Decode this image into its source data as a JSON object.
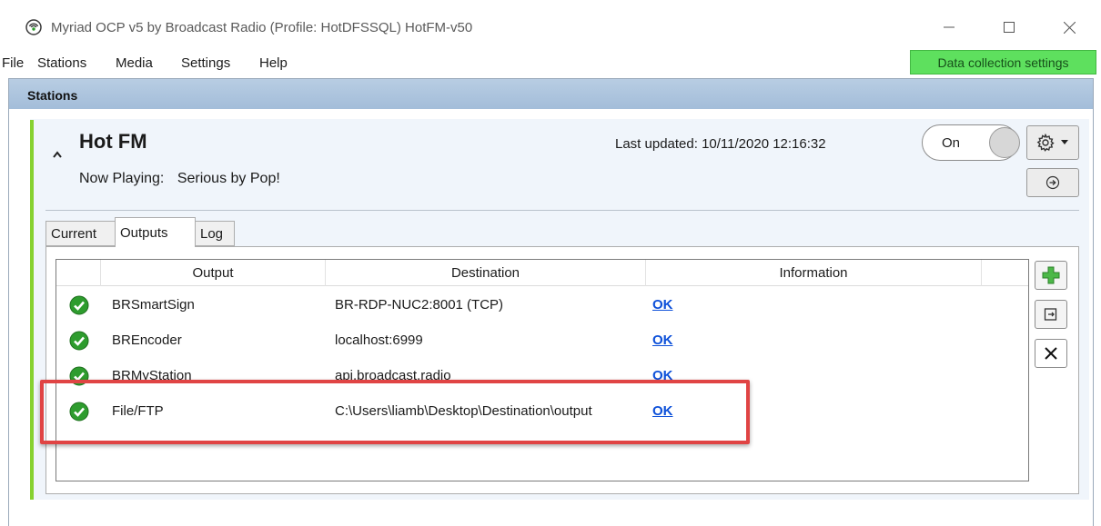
{
  "window": {
    "title": "Myriad OCP v5 by Broadcast Radio (Profile: HotDFSSQL) HotFM-v50",
    "minimize_glyph": "—",
    "maximize_glyph": "☐",
    "close_glyph": "✕"
  },
  "menu": {
    "items": [
      "File",
      "Stations",
      "Media",
      "Settings",
      "Help"
    ],
    "data_collection": "Data collection settings"
  },
  "stations": {
    "header": "Stations",
    "station": {
      "name": "Hot FM",
      "now_playing_label": "Now Playing:",
      "now_playing_value": "Serious by Pop!",
      "last_updated": "Last updated: 10/11/2020 12:16:32",
      "toggle_label": "On",
      "toggle_state": "on"
    },
    "tabs": [
      {
        "label": "Current",
        "active": false
      },
      {
        "label": "Outputs",
        "active": true
      },
      {
        "label": "Log",
        "active": false
      }
    ],
    "columns": [
      "Output",
      "Destination",
      "Information"
    ],
    "rows": [
      {
        "output": "BRSmartSign",
        "destination": "BR-RDP-NUC2:8001 (TCP)",
        "information": "OK",
        "status": "ok"
      },
      {
        "output": "BREncoder",
        "destination": "localhost:6999",
        "information": "OK",
        "status": "ok"
      },
      {
        "output": "BRMyStation",
        "destination": "api.broadcast.radio",
        "information": "OK",
        "status": "ok"
      },
      {
        "output": "File/FTP",
        "destination": "C:\\Users\\liamb\\Desktop\\Destination\\output",
        "information": "OK",
        "status": "ok"
      }
    ]
  },
  "colors": {
    "accent_green": "#87d130",
    "status_ok": "#2e9c2e",
    "link": "#0b4fd9",
    "highlight": "#e04444",
    "header_blue": "#a3bdd9",
    "data_collection_bg": "#5ee05e"
  }
}
